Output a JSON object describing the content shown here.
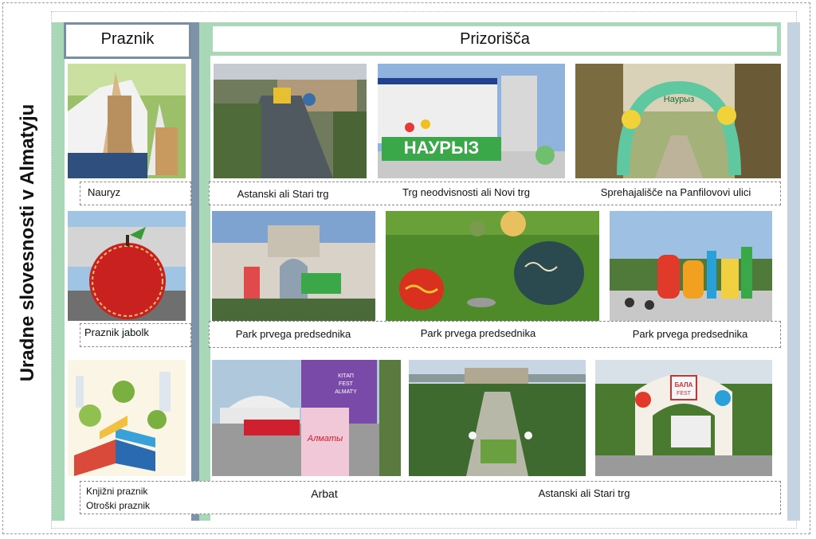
{
  "side_title": "Uradne slovesnosti v Almatyju",
  "headers": {
    "praznik": "Praznik",
    "prizorisca": "Prizorišča"
  },
  "row1": {
    "praznik": "Nauryz",
    "venues": [
      "Astanski ali Stari trg",
      "Trg neodvisnosti ali Novi trg",
      "Sprehajališče na Panfilovovi ulici"
    ],
    "sign_text": "НАУРЫЗ",
    "arch_text": "Наурыз"
  },
  "row2": {
    "praznik": "Praznik jabolk",
    "venues": [
      "Park prvega predsednika",
      "Park prvega predsednika",
      "Park prvega predsednika"
    ]
  },
  "row3": {
    "praznik": [
      "Knjižni praznik",
      "Otroški praznik"
    ],
    "venues": [
      "Arbat",
      "Astanski ali Stari trg"
    ],
    "kitap_text": [
      "КІТАП",
      "FEST",
      "ALMATY"
    ],
    "almaty_logo": "Алматы",
    "bala_text": [
      "БАЛА",
      "FEST"
    ]
  },
  "colors": {
    "green": "#a9d8b8",
    "blue_gray": "#7e93a8",
    "light_blue": "#c5d3e0"
  }
}
